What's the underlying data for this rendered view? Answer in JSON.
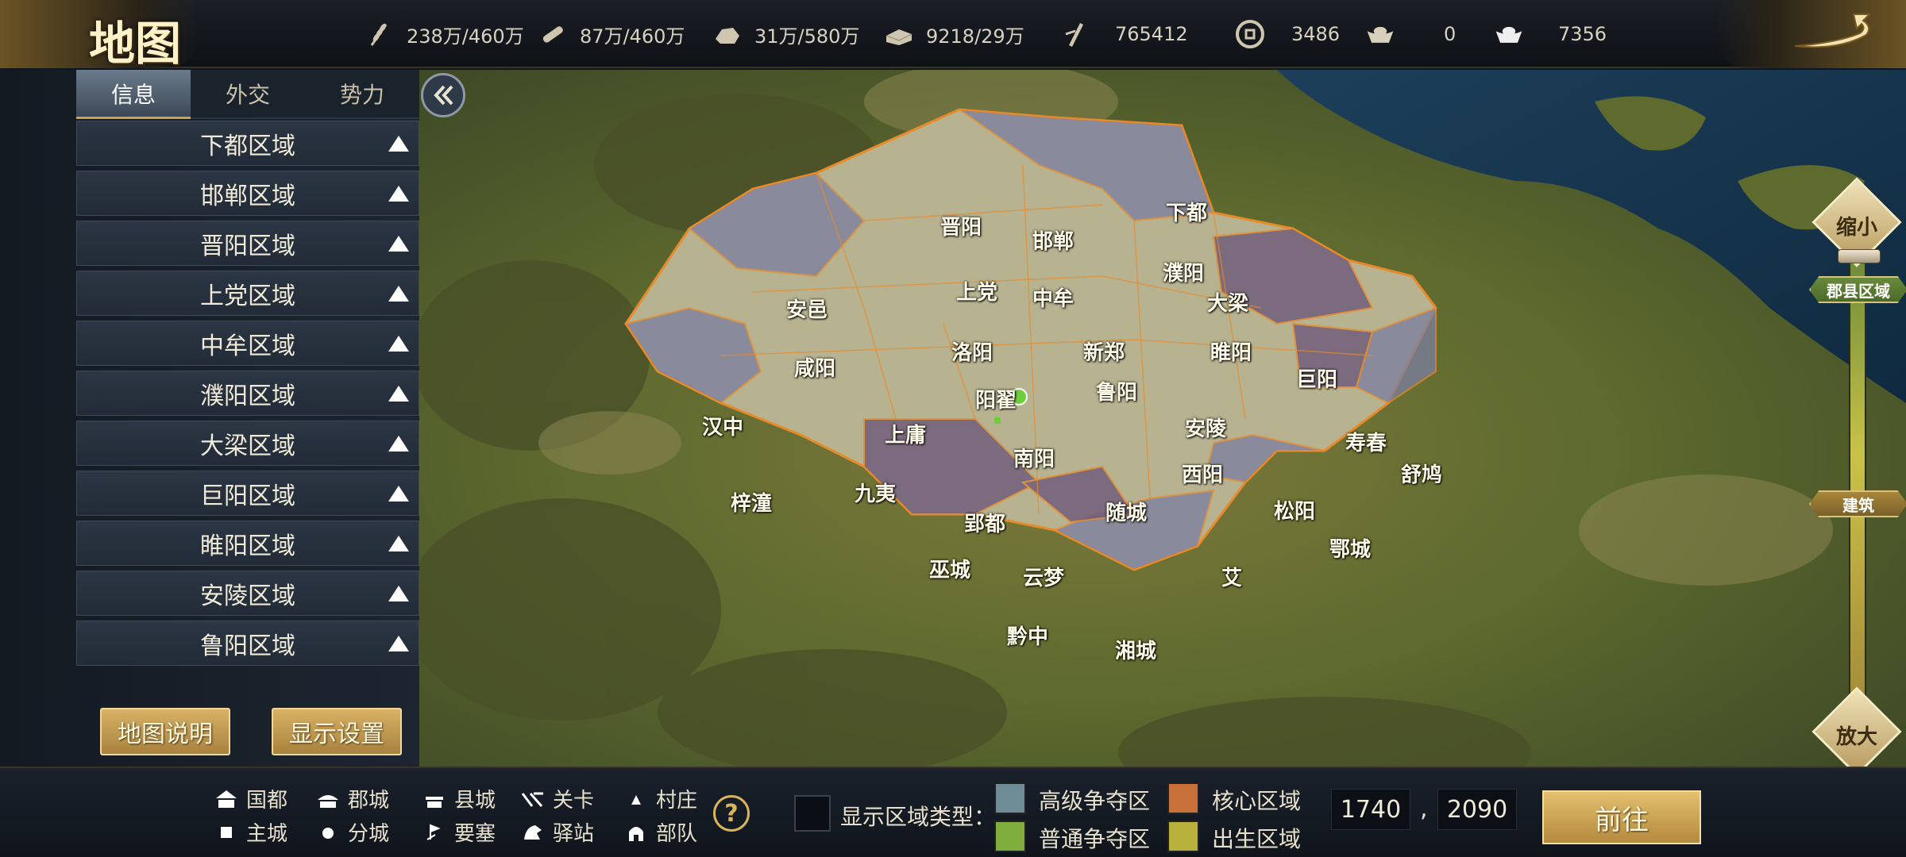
{
  "header": {
    "title": "地图",
    "resources": [
      {
        "icon": "grain-icon",
        "value": "238万/460万"
      },
      {
        "icon": "wood-icon",
        "value": "87万/460万"
      },
      {
        "icon": "stone-icon",
        "value": "31万/580万"
      },
      {
        "icon": "iron-icon",
        "value": "9218/29万"
      },
      {
        "icon": "tiger-tally-icon",
        "value": "765412"
      },
      {
        "icon": "copper-coin-icon",
        "value": "3486"
      },
      {
        "icon": "gold-ingot-icon",
        "value": "0"
      },
      {
        "icon": "silver-ingot-icon",
        "value": "7356"
      }
    ],
    "back_icon": "return-arrow-icon"
  },
  "sidebar": {
    "tabs": [
      {
        "label": "信息",
        "active": true
      },
      {
        "label": "外交",
        "active": false
      },
      {
        "label": "势力",
        "active": false
      }
    ],
    "regions": [
      "下都区域",
      "邯郸区域",
      "晋阳区域",
      "上党区域",
      "中牟区域",
      "濮阳区域",
      "大梁区域",
      "巨阳区域",
      "睢阳区域",
      "安陵区域",
      "鲁阳区域"
    ],
    "map_help_label": "地图说明",
    "display_settings_label": "显示设置"
  },
  "map": {
    "cities": [
      "下都",
      "晋阳",
      "邯郸",
      "濮阳",
      "上党",
      "中牟",
      "大梁",
      "安邑",
      "睢阳",
      "洛阳",
      "新郑",
      "咸阳",
      "巨阳",
      "阳翟",
      "鲁阳",
      "汉中",
      "上庸",
      "安陵",
      "寿春",
      "南阳",
      "西阳",
      "舒鸠",
      "梓潼",
      "九夷",
      "随城",
      "松阳",
      "郢都",
      "鄂城",
      "巫城",
      "云梦",
      "艾",
      "黔中",
      "湘城"
    ]
  },
  "zoom": {
    "zoom_out_label": "缩小",
    "zoom_in_label": "放大",
    "level_county_label": "郡县区域",
    "level_building_label": "建筑"
  },
  "legend": {
    "items": [
      {
        "icon": "capital-icon",
        "label": "国都"
      },
      {
        "icon": "commandery-city-icon",
        "label": "郡城"
      },
      {
        "icon": "county-city-icon",
        "label": "县城"
      },
      {
        "icon": "pass-icon",
        "label": "关卡"
      },
      {
        "icon": "village-icon",
        "label": "村庄"
      },
      {
        "icon": "main-city-icon",
        "label": "主城"
      },
      {
        "icon": "branch-city-icon",
        "label": "分城"
      },
      {
        "icon": "fortress-icon",
        "label": "要塞"
      },
      {
        "icon": "relay-station-icon",
        "label": "驿站"
      },
      {
        "icon": "troop-icon",
        "label": "部队"
      }
    ],
    "region_type_label": "显示区域类型：",
    "region_types": [
      {
        "label": "高级争夺区",
        "color": "#6e8c96"
      },
      {
        "label": "核心区域",
        "color": "#c8703a"
      },
      {
        "label": "普通争夺区",
        "color": "#7fae3e"
      },
      {
        "label": "出生区域",
        "color": "#b8b23c"
      }
    ]
  },
  "coords": {
    "x": "1740",
    "y": "2090",
    "separator": ","
  },
  "go_label": "前往",
  "colors": {
    "gold": "#d9b55a",
    "territory_border": "#e88a2a"
  }
}
